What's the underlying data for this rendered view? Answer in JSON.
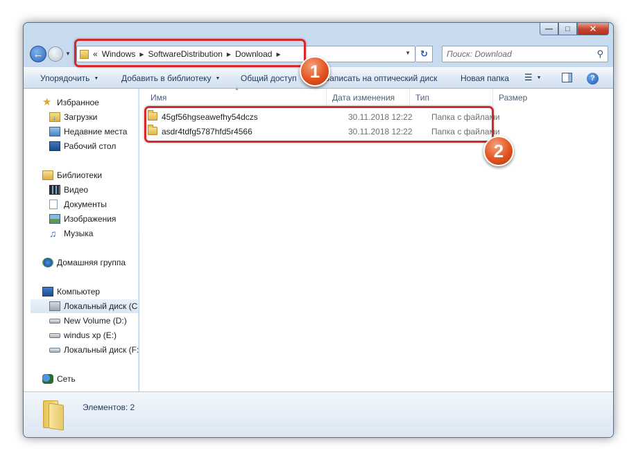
{
  "window": {
    "caption": {
      "minimize": "—",
      "maximize": "□",
      "close": "✕"
    }
  },
  "navbar": {
    "address": {
      "prefix": "«",
      "crumbs": [
        "Windows",
        "SoftwareDistribution",
        "Download"
      ]
    },
    "search_placeholder": "Поиск: Download"
  },
  "toolbar": {
    "organize": "Упорядочить",
    "add_to_library": "Добавить в библиотеку",
    "share": "Общий доступ",
    "burn": "Записать на оптический диск",
    "new_folder": "Новая папка"
  },
  "sidebar": {
    "favorites": {
      "title": "Избранное",
      "items": [
        "Загрузки",
        "Недавние места",
        "Рабочий стол"
      ]
    },
    "libraries": {
      "title": "Библиотеки",
      "items": [
        "Видео",
        "Документы",
        "Изображения",
        "Музыка"
      ]
    },
    "homegroup": "Домашняя группа",
    "computer": {
      "title": "Компьютер",
      "items": [
        "Локальный диск (C",
        "New Volume (D:)",
        "windus xp (E:)",
        "Локальный диск (F:"
      ]
    },
    "network": "Сеть"
  },
  "columns": [
    "Имя",
    "Дата изменения",
    "Тип",
    "Размер"
  ],
  "files": [
    {
      "name": "45gf56hgseawefhy54dczs",
      "date": "30.11.2018 12:22",
      "type": "Папка с файлами"
    },
    {
      "name": "asdr4tdfg5787hfd5r4566",
      "date": "30.11.2018 12:22",
      "type": "Папка с файлами"
    }
  ],
  "status": {
    "text": "Элементов: 2"
  },
  "annotations": {
    "badge1": "1",
    "badge2": "2",
    "color": "#d6282a"
  }
}
